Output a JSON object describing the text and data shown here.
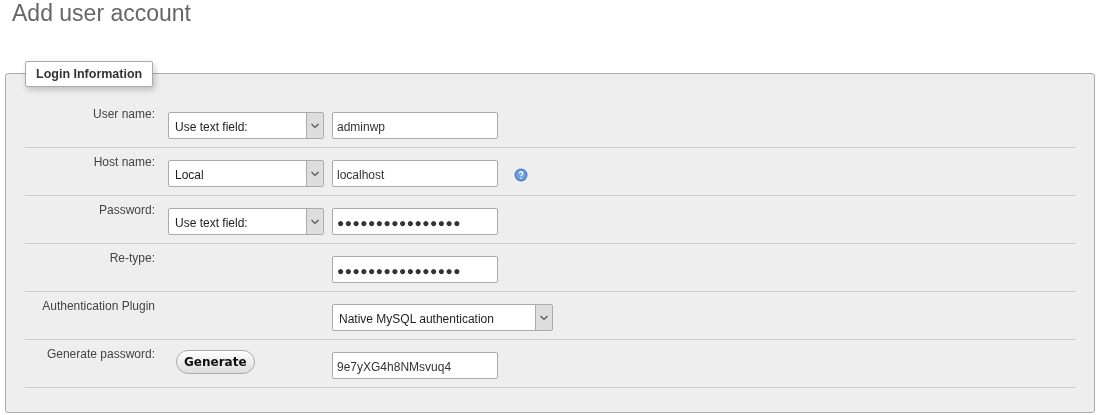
{
  "title": "Add user account",
  "fieldset": {
    "legend": "Login Information",
    "rows": [
      {
        "kind": "select-input",
        "label": "User name:",
        "select": "Use text field:",
        "value": "adminwp",
        "help": false
      },
      {
        "kind": "select-input",
        "label": "Host name:",
        "select": "Local",
        "value": "localhost",
        "help": true
      },
      {
        "kind": "select-input",
        "label": "Password:",
        "select": "Use text field:",
        "value": "●●●●●●●●●●●●●●●●",
        "help": false
      },
      {
        "kind": "input",
        "label": "Re-type:",
        "value": "●●●●●●●●●●●●●●●●",
        "help": false
      },
      {
        "kind": "wide-select",
        "label": "Authentication Plugin",
        "select": "Native MySQL authentication",
        "help": false
      },
      {
        "kind": "button-input",
        "label": "Generate password:",
        "button": "Generate",
        "value": "9e7yXG4h8NMsvuq4",
        "help": false
      }
    ]
  }
}
